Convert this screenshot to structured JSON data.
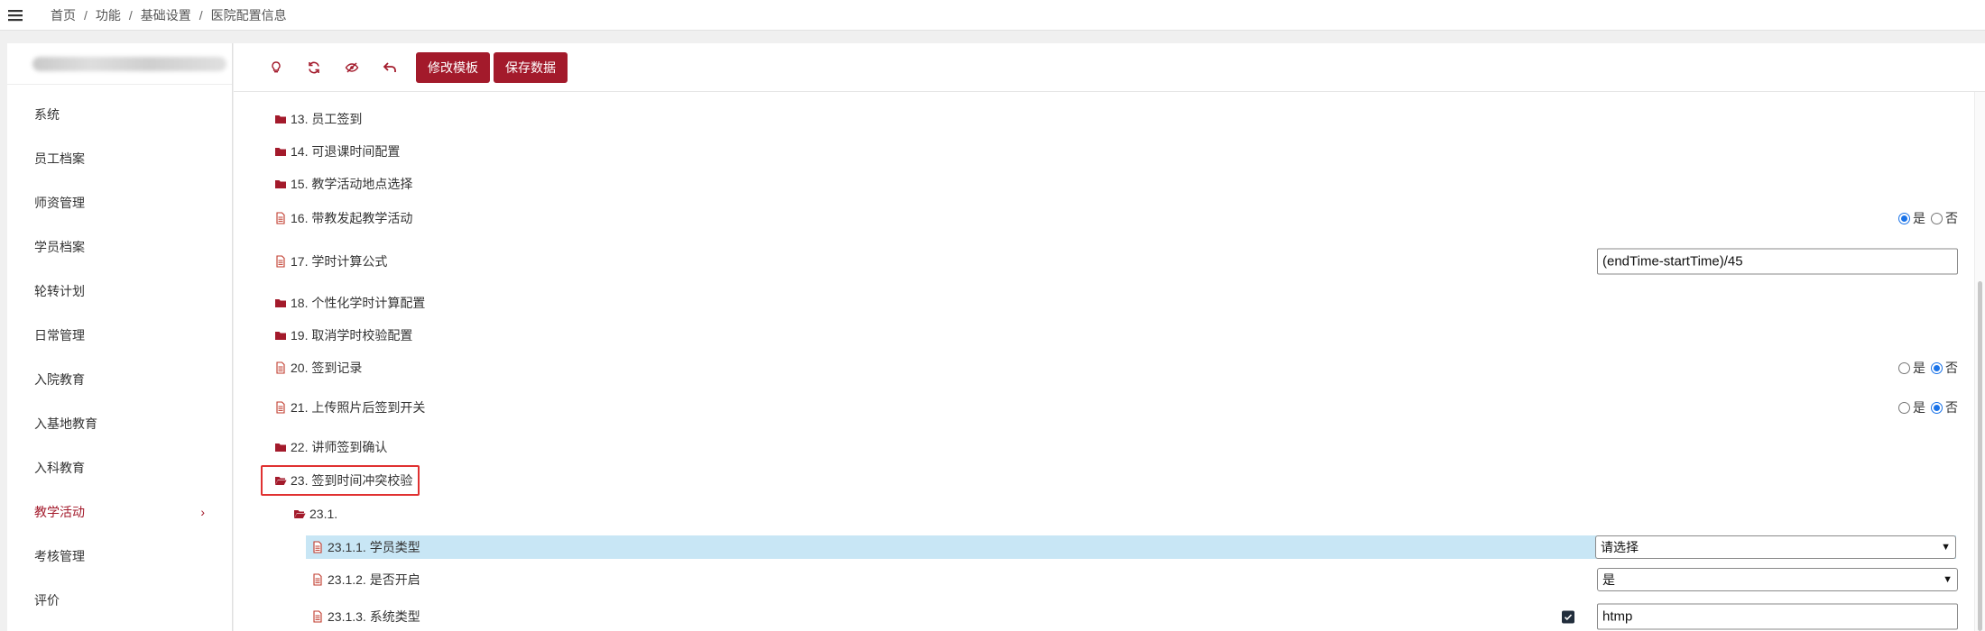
{
  "breadcrumb": [
    "首页",
    "功能",
    "基础设置",
    "医院配置信息"
  ],
  "breadcrumb_sep": "/",
  "sidebar": {
    "items": [
      {
        "label": "系统"
      },
      {
        "label": "员工档案"
      },
      {
        "label": "师资管理"
      },
      {
        "label": "学员档案"
      },
      {
        "label": "轮转计划"
      },
      {
        "label": "日常管理"
      },
      {
        "label": "入院教育"
      },
      {
        "label": "入基地教育"
      },
      {
        "label": "入科教育"
      },
      {
        "label": "教学活动",
        "active": true,
        "chevron": "›"
      },
      {
        "label": "考核管理"
      },
      {
        "label": "评价"
      }
    ]
  },
  "toolbar": {
    "icons": [
      "bulb-icon",
      "refresh-icon",
      "eye-slash-icon",
      "undo-icon"
    ],
    "edit_template_label": "修改模板",
    "save_data_label": "保存数据"
  },
  "colors": {
    "accent": "#a31a2b",
    "highlight": "#c8e6f5",
    "focus_border": "#e03131"
  },
  "tree": [
    {
      "label": "13. 员工签到",
      "icon": "folder-icon",
      "indent": 0
    },
    {
      "label": "14. 可退课时间配置",
      "icon": "folder-icon",
      "indent": 0
    },
    {
      "label": "15. 教学活动地点选择",
      "icon": "folder-icon",
      "indent": 0
    },
    {
      "label": "16. 带教发起教学活动",
      "icon": "file-icon",
      "indent": 0,
      "control": {
        "type": "radio",
        "options": [
          "是",
          "否"
        ],
        "selected": "是"
      }
    },
    {
      "label": "17. 学时计算公式",
      "icon": "file-icon",
      "indent": 0,
      "control": {
        "type": "text",
        "value": "(endTime-startTime)/45"
      }
    },
    {
      "label": "18. 个性化学时计算配置",
      "icon": "folder-icon",
      "indent": 0
    },
    {
      "label": "19. 取消学时校验配置",
      "icon": "folder-icon",
      "indent": 0
    },
    {
      "label": "20. 签到记录",
      "icon": "file-icon",
      "indent": 0,
      "control": {
        "type": "radio",
        "options": [
          "是",
          "否"
        ],
        "selected": "否"
      }
    },
    {
      "label": "21. 上传照片后签到开关",
      "icon": "file-icon",
      "indent": 0,
      "control": {
        "type": "radio",
        "options": [
          "是",
          "否"
        ],
        "selected": "否"
      }
    },
    {
      "label": "22. 讲师签到确认",
      "icon": "folder-icon",
      "indent": 0
    },
    {
      "label": "23. 签到时间冲突校验",
      "icon": "folder-open-icon",
      "indent": 0,
      "selected": true
    },
    {
      "label": "23.1.",
      "icon": "folder-open-icon",
      "indent": 1
    },
    {
      "label": "23.1.1. 学员类型",
      "icon": "file-icon",
      "indent": 2,
      "highlight": true,
      "control": {
        "type": "select",
        "value": "请选择"
      }
    },
    {
      "label": "23.1.2. 是否开启",
      "icon": "file-icon",
      "indent": 2,
      "control": {
        "type": "select",
        "value": "是"
      }
    },
    {
      "label": "23.1.3. 系统类型",
      "icon": "file-icon",
      "indent": 2,
      "control": {
        "type": "checkbox-text",
        "checked": true,
        "value": "htmp"
      }
    }
  ]
}
